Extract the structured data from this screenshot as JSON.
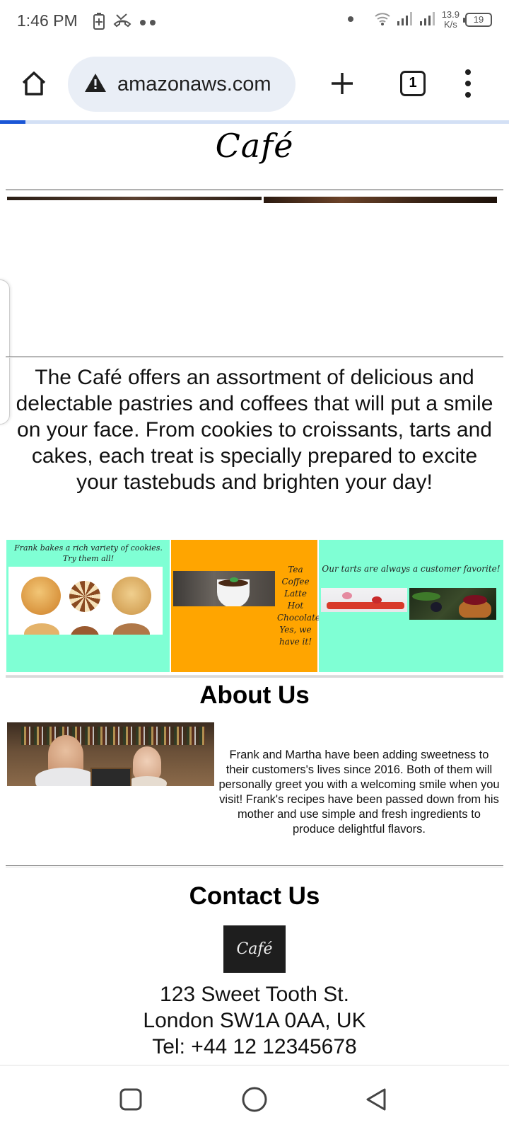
{
  "status_bar": {
    "time": "1:46 PM",
    "net_speed_value": "13.9",
    "net_speed_unit": "K/s",
    "battery": "19"
  },
  "browser": {
    "url": "amazonaws.com",
    "tab_count": "1",
    "load_progress": 0.05
  },
  "page": {
    "logo_text": "Café",
    "intro": "The Café offers an assortment of delicious and delectable pastries and coffees that will put a smile on your face. From cookies to croissants, tarts and cakes, each treat is specially prepared to excite your tastebuds and brighten your day!",
    "gallery": {
      "cookies_caption": "Frank bakes a rich variety of cookies. Try them all!",
      "drinks": [
        "Tea",
        "Coffee",
        "Latte",
        "Hot",
        "Chocolate",
        "Yes, we",
        "have it!"
      ],
      "tarts_caption": "Our tarts are always a customer favorite!"
    },
    "about": {
      "title": "About Us",
      "text": "Frank and Martha have been adding sweetness to their customers's lives since 2016. Both of them will personally greet you with a welcoming smile when you visit! Frank's recipes have been passed down from his mother and use simple and fresh ingredients to produce delightful flavors."
    },
    "contact": {
      "title": "Contact Us",
      "logo_text": "Café",
      "address_line1": "123 Sweet Tooth St.",
      "address_line2": "London SW1A 0AA, UK",
      "phone": "Tel: +44 12 12345678"
    }
  },
  "colors": {
    "aquamarine": "#7fffd4",
    "orange": "#ffa500",
    "progress": "#1a56d6"
  }
}
